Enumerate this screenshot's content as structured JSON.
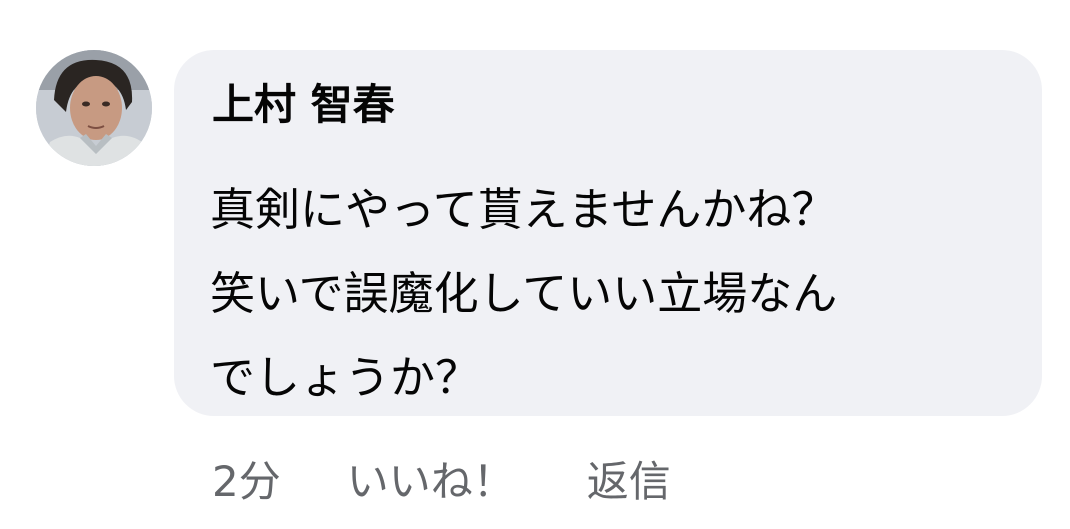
{
  "comment": {
    "author": "上村 智春",
    "text_lines": [
      "真剣にやって貰えませんかね？",
      "笑いで誤魔化していい立場なん",
      "でしょうか？"
    ],
    "time": "2分",
    "like_label": "いいね！",
    "reply_label": "返信",
    "avatar_icon": "profile-photo"
  }
}
